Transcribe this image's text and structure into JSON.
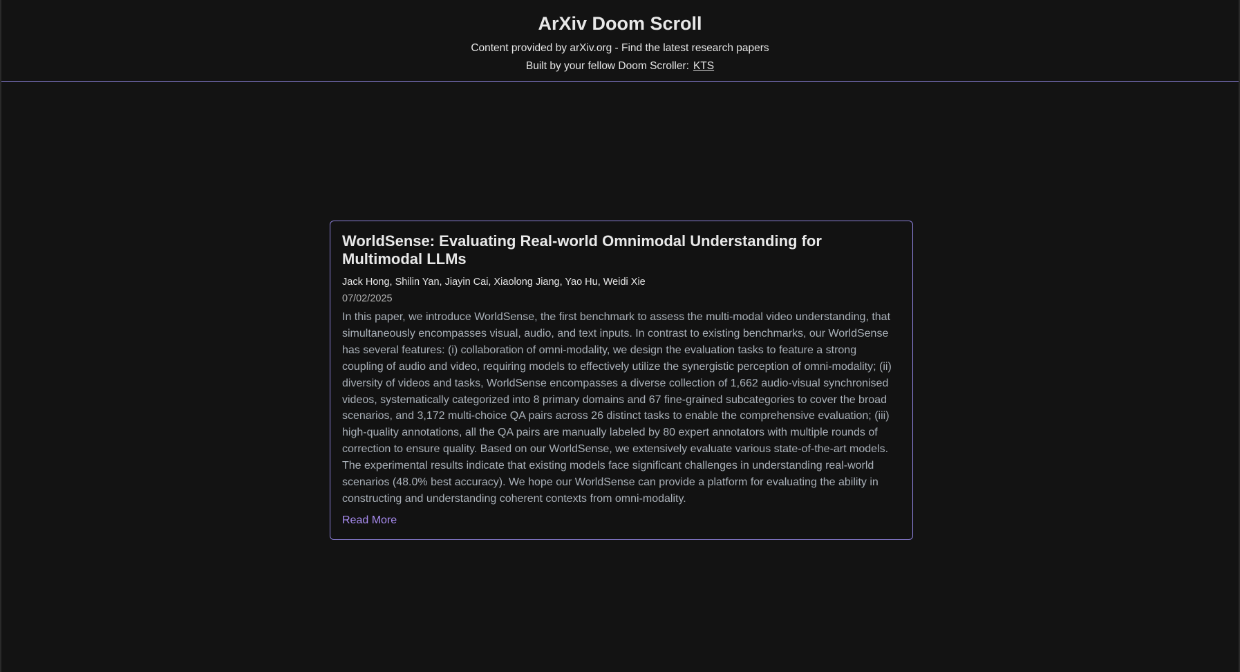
{
  "header": {
    "title": "ArXiv Doom Scroll",
    "subtitle": "Content provided by arXiv.org - Find the latest research papers",
    "credit_prefix": "Built by your fellow Doom Scroller:",
    "credit_link": "KTS"
  },
  "paper": {
    "title": "WorldSense: Evaluating Real-world Omnimodal Understanding for Multimodal LLMs",
    "authors": "Jack Hong, Shilin Yan, Jiayin Cai, Xiaolong Jiang, Yao Hu, Weidi Xie",
    "date": "07/02/2025",
    "abstract": "In this paper, we introduce WorldSense, the first benchmark to assess the multi-modal video understanding, that simultaneously encompasses visual, audio, and text inputs. In contrast to existing benchmarks, our WorldSense has several features: (i) collaboration of omni-modality, we design the evaluation tasks to feature a strong coupling of audio and video, requiring models to effectively utilize the synergistic perception of omni-modality; (ii) diversity of videos and tasks, WorldSense encompasses a diverse collection of 1,662 audio-visual synchronised videos, systematically categorized into 8 primary domains and 67 fine-grained subcategories to cover the broad scenarios, and 3,172 multi-choice QA pairs across 26 distinct tasks to enable the comprehensive evaluation; (iii) high-quality annotations, all the QA pairs are manually labeled by 80 expert annotators with multiple rounds of correction to ensure quality. Based on our WorldSense, we extensively evaluate various state-of-the-art models. The experimental results indicate that existing models face significant challenges in understanding real-world scenarios (48.0% best accuracy). We hope our WorldSense can provide a platform for evaluating the ability in constructing and understanding coherent contexts from omni-modality.",
    "read_more_label": "Read More"
  },
  "colors": {
    "background": "#131313",
    "accent": "#8a7fd6",
    "link": "#a88cf0",
    "abstract_text": "#a9b0b8"
  }
}
